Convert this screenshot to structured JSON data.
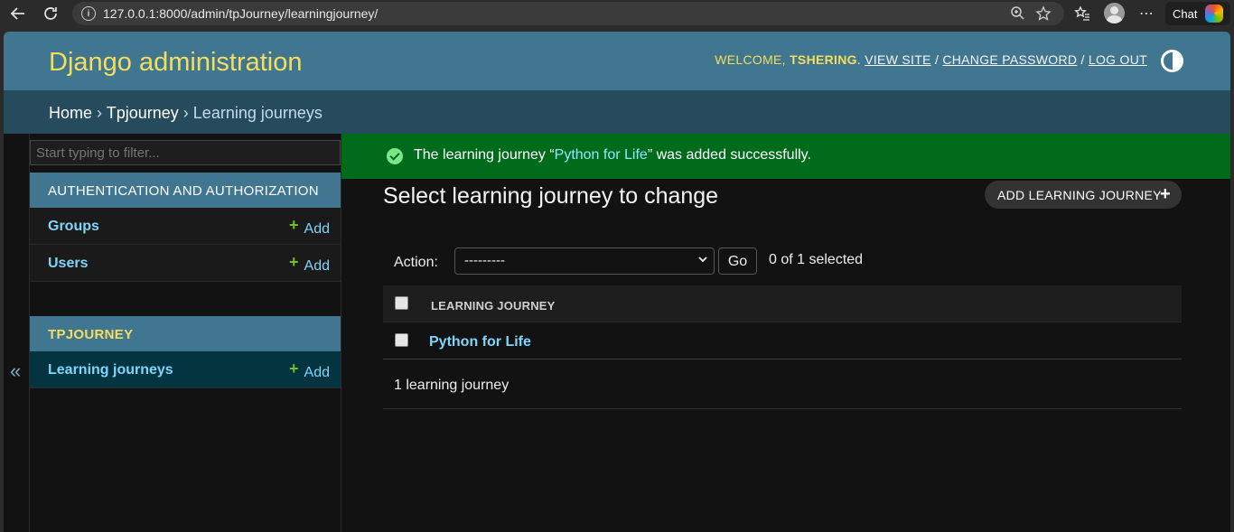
{
  "browser": {
    "back_icon": "back-arrow-icon",
    "refresh_icon": "refresh-icon",
    "url": "127.0.0.1:8000/admin/tpJourney/learningjourney/",
    "chat_label": "Chat"
  },
  "header": {
    "site_name": "Django administration",
    "welcome": "WELCOME,",
    "username": "TSHERING",
    "view_site": "VIEW SITE",
    "change_password": "CHANGE PASSWORD",
    "log_out": "LOG OUT",
    "separator": "/"
  },
  "breadcrumbs": {
    "home": "Home",
    "app": "Tpjourney",
    "current": "Learning journeys",
    "separator": "›"
  },
  "sidebar": {
    "toggle": "«",
    "filter_placeholder": "Start typing to filter...",
    "modules": [
      {
        "caption": "AUTHENTICATION AND AUTHORIZATION",
        "items": [
          {
            "label": "Groups",
            "add": "Add"
          },
          {
            "label": "Users",
            "add": "Add"
          }
        ]
      },
      {
        "caption": "TPJOURNEY",
        "items": [
          {
            "label": "Learning journeys",
            "add": "Add"
          }
        ]
      }
    ]
  },
  "message": {
    "prefix": "The learning journey “",
    "object": "Python for Life",
    "suffix": "” was added successfully."
  },
  "main": {
    "title": "Select learning journey to change",
    "add_button": "ADD LEARNING JOURNEY",
    "action_label": "Action:",
    "action_value": "---------",
    "go": "Go",
    "selected": "0 of 1 selected",
    "column": "LEARNING JOURNEY",
    "rows": [
      "Python for Life"
    ],
    "count": "1 learning journey"
  },
  "colors": {
    "header_bg": "#417690",
    "breadcrumbs_bg": "#264b5d",
    "accent_yellow": "#f5dd5d",
    "success_bg": "#006b1b",
    "link": "#81d4fa"
  }
}
